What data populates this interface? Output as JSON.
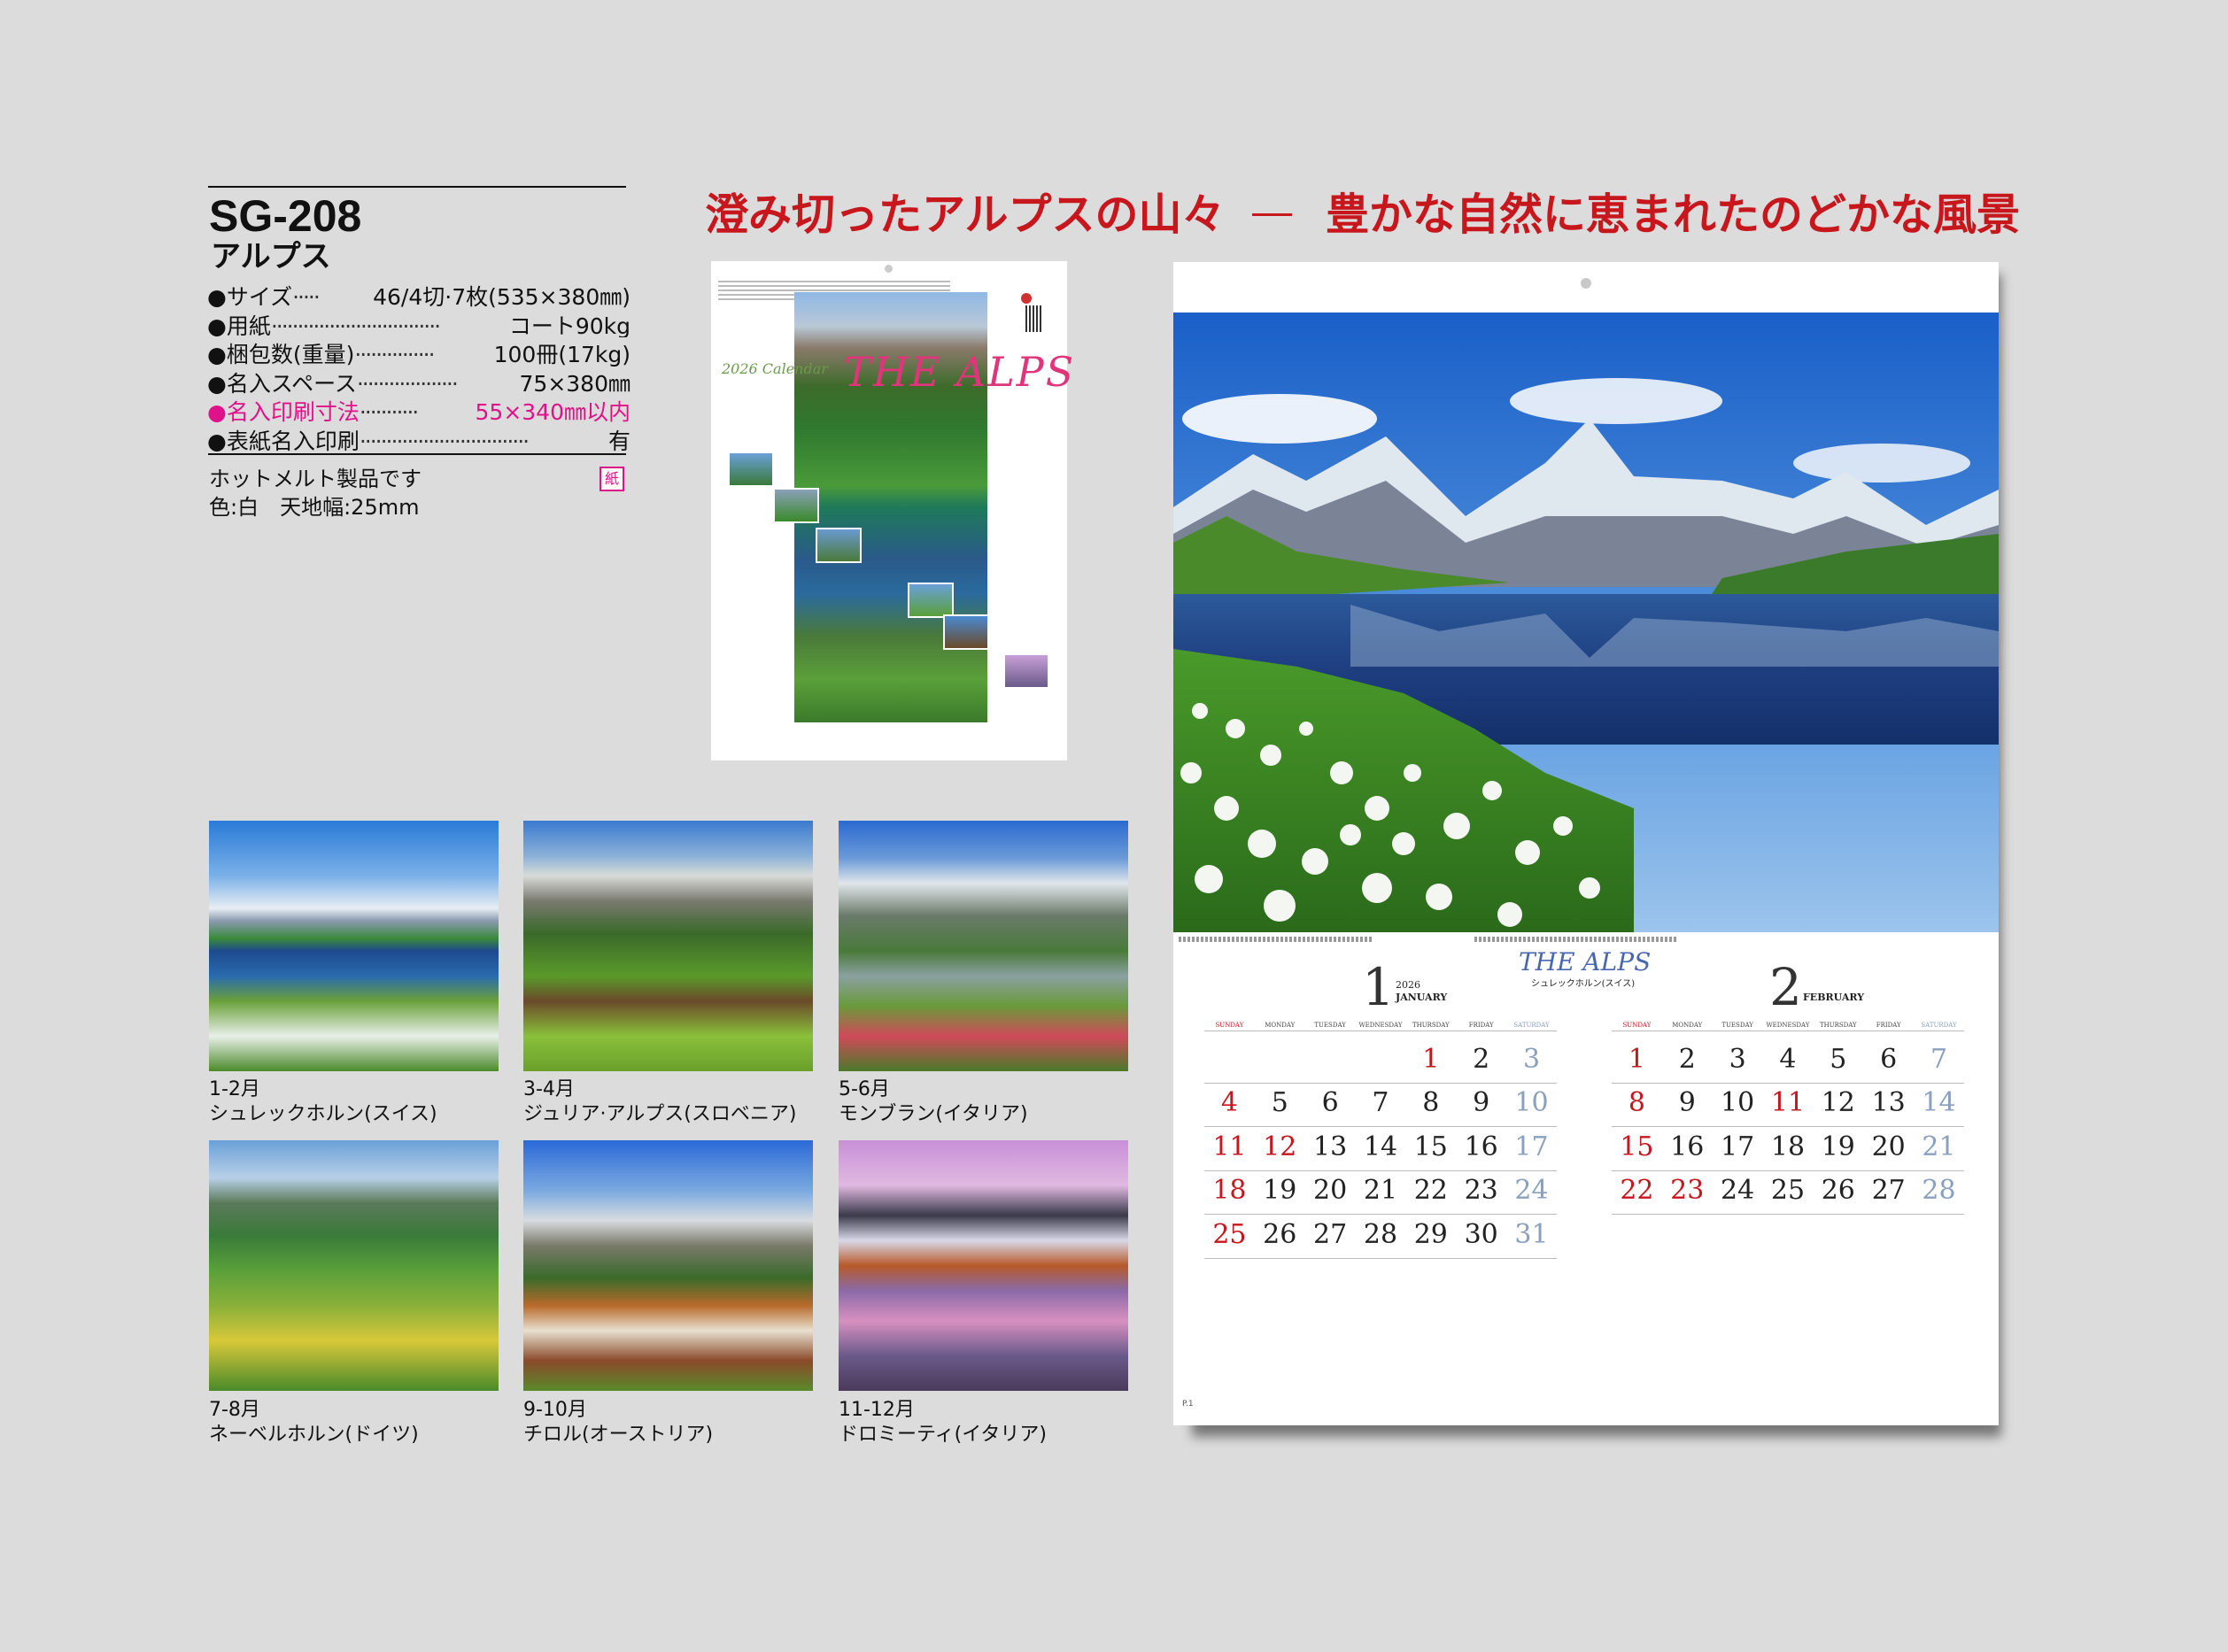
{
  "spec": {
    "model": "SG-208",
    "name": "アルプス",
    "rows": [
      {
        "label": "●サイズ",
        "dots": "·····",
        "value": "46/4切·7枚(535×380㎜)"
      },
      {
        "label": "●用紙",
        "dots": "································",
        "value": "コート90kg"
      },
      {
        "label": "●梱包数(重量)",
        "dots": "···············",
        "value": "100冊(17kg)"
      },
      {
        "label": "●名入スペース",
        "dots": "···················",
        "value": "75×380㎜"
      },
      {
        "label": "●名入印刷寸法",
        "dots": "···········",
        "value": "55×340㎜以内",
        "highlight": true
      },
      {
        "label": "●表紙名入印刷",
        "dots": "································",
        "value": "有"
      }
    ],
    "note1": "ホットメルト製品です",
    "note2": "色:白　天地幅:25mm",
    "badge": "紙"
  },
  "headline": {
    "left": "澄み切ったアルプスの山々",
    "right": "豊かな自然に恵まれたのどかな風景"
  },
  "cover": {
    "calendar_text": "2026 Calendar",
    "title": "THE ALPS"
  },
  "months": [
    {
      "period": "1-2月",
      "place": "シュレックホルン(スイス)"
    },
    {
      "period": "3-4月",
      "place": "ジュリア·アルプス(スロベニア)"
    },
    {
      "period": "5-6月",
      "place": "モンブラン(イタリア)"
    },
    {
      "period": "7-8月",
      "place": "ネーベルホルン(ドイツ)"
    },
    {
      "period": "9-10月",
      "place": "チロル(オーストリア)"
    },
    {
      "period": "11-12月",
      "place": "ドロミーティ(イタリア)"
    }
  ],
  "calendar": {
    "brand": "THE ALPS",
    "brand_sub": "シュレックホルン(スイス)",
    "page_no": "P.1",
    "weekdays": [
      "SUNDAY",
      "MONDAY",
      "TUESDAY",
      "WEDNESDAY",
      "THURSDAY",
      "FRIDAY",
      "SATURDAY"
    ],
    "jan": {
      "num": "1",
      "name": "JANUARY",
      "year": "2026",
      "weeks": [
        [
          "",
          "",
          "",
          "",
          "1",
          "2",
          "3"
        ],
        [
          "4",
          "5",
          "6",
          "7",
          "8",
          "9",
          "10"
        ],
        [
          "11",
          "12",
          "13",
          "14",
          "15",
          "16",
          "17"
        ],
        [
          "18",
          "19",
          "20",
          "21",
          "22",
          "23",
          "24"
        ],
        [
          "25",
          "26",
          "27",
          "28",
          "29",
          "30",
          "31"
        ]
      ],
      "holidays": [
        "1",
        "12"
      ]
    },
    "feb": {
      "num": "2",
      "name": "FEBRUARY",
      "weeks": [
        [
          "1",
          "2",
          "3",
          "4",
          "5",
          "6",
          "7"
        ],
        [
          "8",
          "9",
          "10",
          "11",
          "12",
          "13",
          "14"
        ],
        [
          "15",
          "16",
          "17",
          "18",
          "19",
          "20",
          "21"
        ],
        [
          "22",
          "23",
          "24",
          "25",
          "26",
          "27",
          "28"
        ]
      ],
      "holidays": [
        "11",
        "23"
      ]
    }
  },
  "colors": {
    "accent": "#c8161d",
    "highlight": "#e0128a",
    "saturday": "#8aa0bf",
    "brand": "#4a66b0"
  }
}
